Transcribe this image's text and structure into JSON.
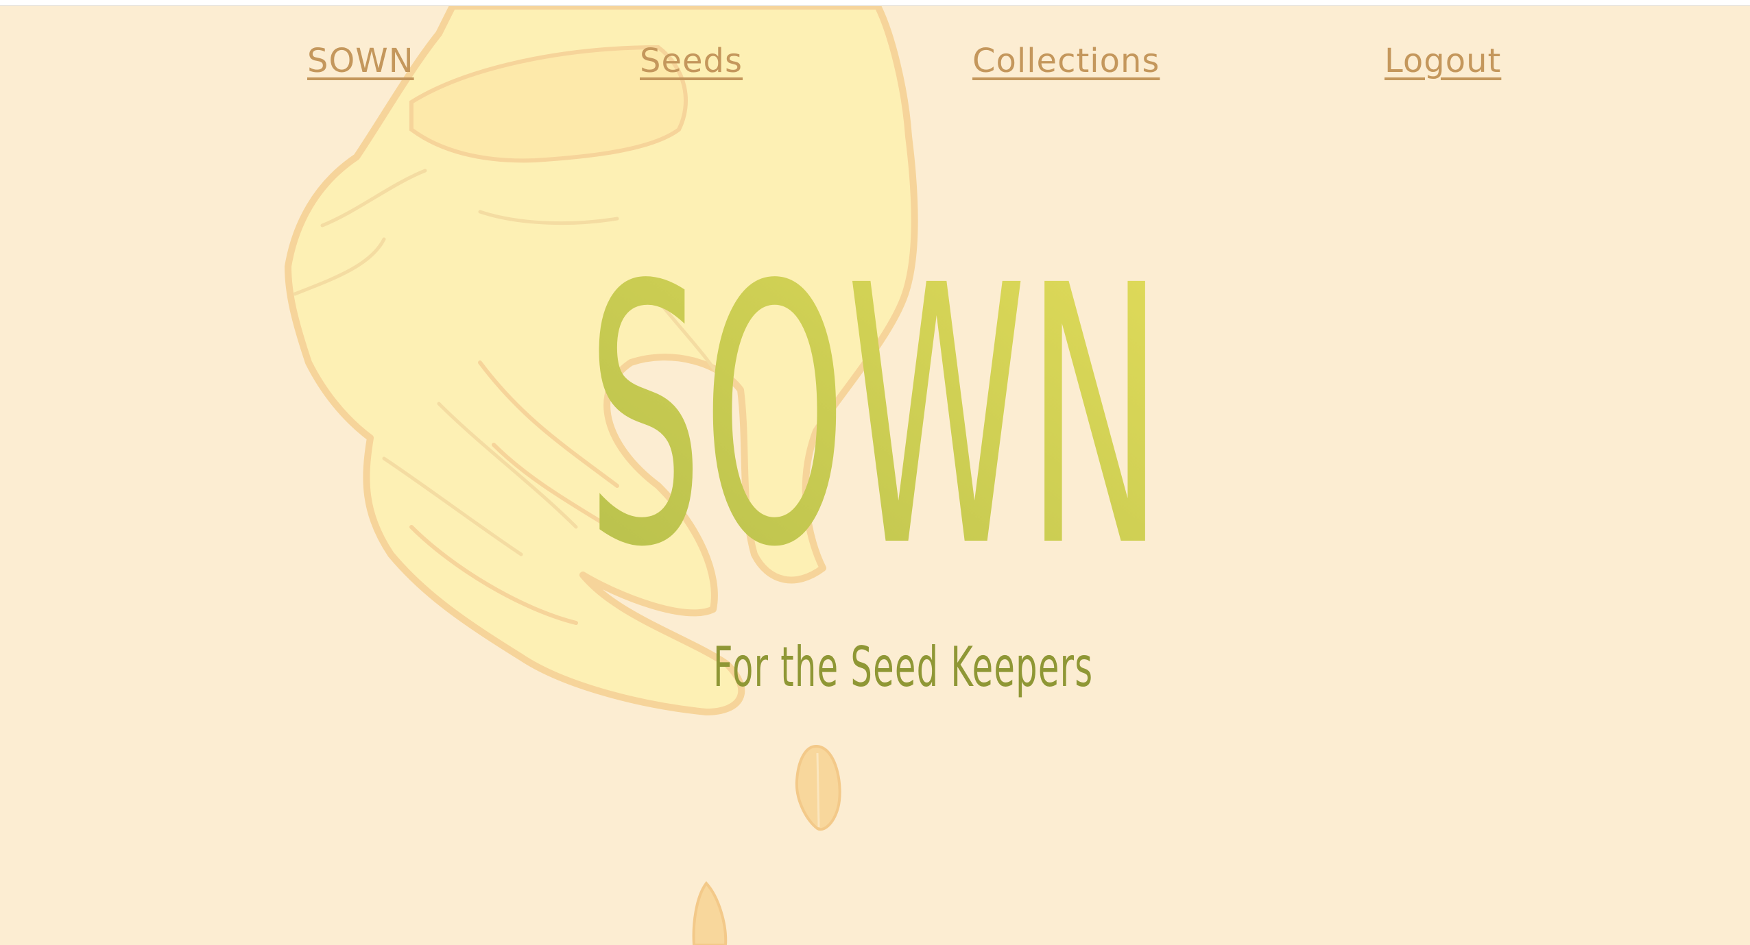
{
  "nav": {
    "home": "SOWN",
    "seeds": "Seeds",
    "collections": "Collections",
    "logout": "Logout"
  },
  "hero": {
    "title": "SOWN",
    "subtitle": "For the Seed Keepers"
  },
  "colors": {
    "background": "#fcedd2",
    "nav_link": "#c4975c",
    "title_start": "#b6bf4c",
    "title_end": "#e2dc5a",
    "subtitle": "#8f9735",
    "hand_fill": "#fdf0b4",
    "hand_outline": "#f6d49a"
  }
}
